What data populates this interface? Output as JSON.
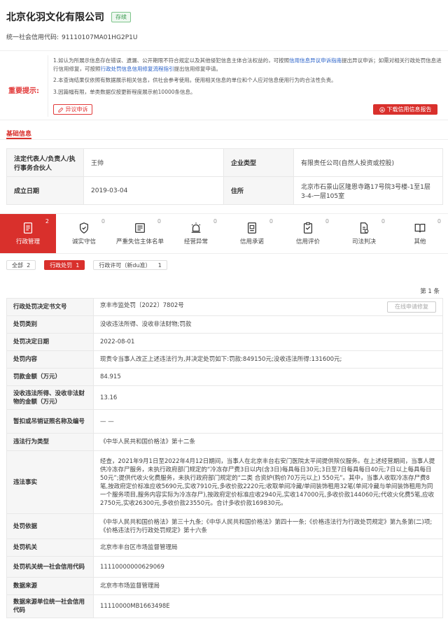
{
  "company": {
    "name": "北京化羽文化有限公司",
    "status": "存续",
    "credit_label": "统一社会信用代码:",
    "credit_code": "91110107MA01HG2P1U"
  },
  "notice": {
    "label": "重要提示:",
    "p1_a": "1.如认为所展示信息存在错误、遗漏、公开期限不符合规定以及其他侵犯信息主体合法权益的，可按照",
    "p1_link": "信用信息异议申诉指南",
    "p1_b": "提出异议申诉；如需对相关行政处罚信息进行信用修复，可按照",
    "p1_link2": "行政处罚信息信用修复流程指引",
    "p1_c": "提出信用修复申请。",
    "p2": "2.本查询结果仅依照有数据展示相关信息，供社会参考使用。使用相关信息的单位和个人应对信息使用行为的合法性负责。",
    "p3": "3.因篇幅有限，单类数据仅按更新程度展示前10000条信息。",
    "appeal": "异议申诉",
    "download": "下载信用信息报告"
  },
  "basic": {
    "title": "基础信息",
    "legal_rep_label": "法定代表人/负责人/执行事务合伙人",
    "legal_rep": "王帅",
    "type_label": "企业类型",
    "type": "有限责任公司(自然人投资或控股)",
    "date_label": "成立日期",
    "date": "2019-03-04",
    "addr_label": "住所",
    "addr": "北京市石景山区隆恩寺路17号院3号楼-1至1层3-4-一层105室"
  },
  "tabs": [
    {
      "label": "行政管理",
      "count": "2"
    },
    {
      "label": "诚实守信",
      "count": "0"
    },
    {
      "label": "严重失信主体名单",
      "count": "0"
    },
    {
      "label": "经营异常",
      "count": "0"
    },
    {
      "label": "信用承诺",
      "count": "0"
    },
    {
      "label": "信用评价",
      "count": "0"
    },
    {
      "label": "司法判决",
      "count": "0"
    },
    {
      "label": "其他",
      "count": "0"
    }
  ],
  "filters": [
    {
      "label": "全部",
      "count": "2"
    },
    {
      "label": "行政处罚",
      "count": "1"
    },
    {
      "label": "行政许可（新du准）",
      "count": "1"
    }
  ],
  "page_count": "第 1 条",
  "detail": {
    "recheck": "在线申请修复",
    "rows": [
      {
        "k": "行政处罚决定书文号",
        "v": "京丰市监处罚〔2022〕7802号"
      },
      {
        "k": "处罚类别",
        "v": "没收违法所得、没收非法财物;罚款"
      },
      {
        "k": "处罚决定日期",
        "v": "2022-08-01"
      },
      {
        "k": "处罚内容",
        "v": "现责令当事人改正上述违法行为,并决定处罚如下:罚款:849150元;没收违法所得:131600元;"
      },
      {
        "k": "罚款金额（万元）",
        "v": "84.915"
      },
      {
        "k": "没收违法所得、没收非法财物的金额（万元）",
        "v": "13.16"
      },
      {
        "k": "暂扣或吊销证照名称及编号",
        "v": "— —"
      },
      {
        "k": "违法行为类型",
        "v": "《中华人民共和国价格法》第十二条"
      },
      {
        "k": "违法事实",
        "v": "经查，2021年9月1日至2022年4月12日期间，当事人在北京丰台右安门医院太平间提供殡仪服务。在上述经营期间，当事人提供冷冻存尸服务，未执行政府部门规定的“冷冻存尸费3日以内(含3日)每具每日30元;3日至7日每具每日40元;7日以上每具每日50元”;提供代收火化费服务，未执行政府部门规定的“二类 合资炉(购价70万元以上) 550元”。其中，当事人收取冷冻存尸费8笔,按政府定价标准应收5690元,实收7910元,多收价款2220元;收取单间冷藏/单间装饰租用32笔(单间冷藏与单间装饰租用为同一个服务项目,服务内容实际为冷冻存尸),按政府定价标准应收2940元,实收147000元,多收价款144060元;代收火化费5笔,应收2750元,实收26300元,多收价款23550元。合计多收价款169830元。"
      },
      {
        "k": "处罚依据",
        "v": "《中华人民共和国价格法》第三十九条;《中华人民共和国价格法》第四十一条;《价格违法行为行政处罚规定》第九条第(二)项;《价格违法行为行政处罚规定》第十六条"
      },
      {
        "k": "处罚机关",
        "v": "北京市丰台区市场监督管理局"
      },
      {
        "k": "处罚机关统一社会信用代码",
        "v": "11110000000629069"
      },
      {
        "k": "数据来源",
        "v": "北京市市场监督管理局"
      },
      {
        "k": "数据来源单位统一社会信用代码",
        "v": "11110000MB1663498E"
      }
    ]
  }
}
